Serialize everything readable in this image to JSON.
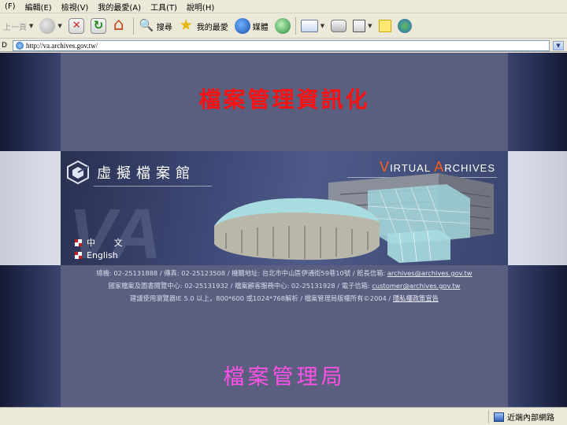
{
  "menu": {
    "items": [
      "(F)",
      "編輯(E)",
      "檢視(V)",
      "我的最愛(A)",
      "工具(T)",
      "說明(H)"
    ]
  },
  "toolbar": {
    "back_label": "上一頁",
    "search_label": "搜尋",
    "favorites_label": "我的最愛",
    "media_label": "媒體"
  },
  "address": {
    "prefix": "D",
    "url": "http://va.archives.gov.tw/"
  },
  "page": {
    "title": "檔案管理資訊化",
    "banner": {
      "logo_text": "虛擬檔案館",
      "va_title_v": "V",
      "va_title_rest1": "IRTUAL ",
      "va_title_a": "A",
      "va_title_rest2": "RCHIVES",
      "lang_zh": "中 文",
      "lang_en": "English"
    },
    "info_line1_text": "總機: 02-25131888 / 傳真: 02-25123508 / 機關地址: 台北市中山區伊通街59巷10號 / 館長信箱: ",
    "info_line1_link": "archives@archives.gov.tw",
    "info_line2_text": "國家檔案及圖書閱覽中心: 02-25131932 / 檔案顧客服務中心: 02-25131928 / 電子信箱: ",
    "info_line2_link": "customer@archives.gov.tw",
    "info_line3_text": "建議使用瀏覽器IE 5.0 以上，800*600 或1024*768解析 / 檔案管理局版權所有©2004 / ",
    "info_line3_link": "隱私權政策宣告",
    "bottom_title": "檔案管理局"
  },
  "status": {
    "zone": "近端內部網路"
  },
  "colors": {
    "title_red": "#ff1010",
    "bottom_magenta": "#ff50e6",
    "page_bg": "#5a5f80"
  }
}
